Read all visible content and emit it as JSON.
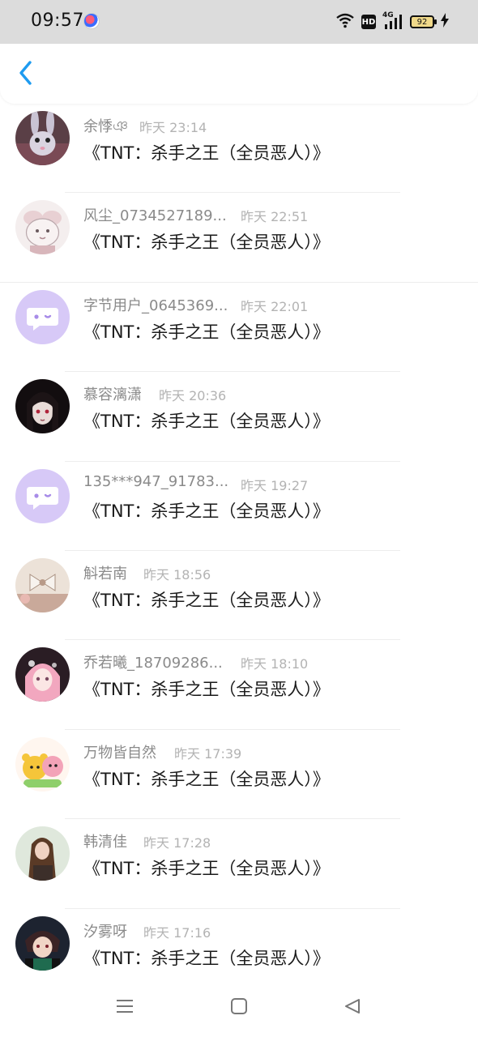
{
  "status_bar": {
    "time": "09:57",
    "hd_label": "HD",
    "network_label": "4G",
    "battery_level": "92"
  },
  "header": {
    "back_icon": "chevron-left-icon",
    "accent_color": "#1e9bf0"
  },
  "messages": [
    {
      "username": "余悸ঞ",
      "time": "昨天 23:14",
      "text": "《TNT：杀手之王（全员恶人）》",
      "avatar_icon": "bunny-avatar"
    },
    {
      "username": "风尘_0734527189...",
      "time": "昨天 22:51",
      "text": "《TNT：杀手之王（全员恶人）》",
      "avatar_icon": "sketch-avatar"
    },
    {
      "username": "字节用户_0645369...",
      "time": "昨天 22:01",
      "text": "《TNT：杀手之王（全员恶人）》",
      "avatar_icon": "default-chat-avatar"
    },
    {
      "username": "慕容漓潇",
      "time": "昨天 20:36",
      "text": "《TNT：杀手之王（全员恶人）》",
      "avatar_icon": "anime-girl-dark-avatar"
    },
    {
      "username": "135***947_91783...",
      "time": "昨天 19:27",
      "text": "《TNT：杀手之王（全员恶人）》",
      "avatar_icon": "default-chat-avatar"
    },
    {
      "username": "斛若南",
      "time": "昨天 18:56",
      "text": "《TNT：杀手之王（全员恶人）》",
      "avatar_icon": "bow-avatar"
    },
    {
      "username": "乔若曦_18709286...",
      "time": "昨天 18:10",
      "text": "《TNT：杀手之王（全员恶人）》",
      "avatar_icon": "anime-girl-pink-avatar"
    },
    {
      "username": "万物皆自然",
      "time": "昨天 17:39",
      "text": "《TNT：杀手之王（全员恶人）》",
      "avatar_icon": "cartoon-bear-avatar"
    },
    {
      "username": "韩清佳",
      "time": "昨天 17:28",
      "text": "《TNT：杀手之王（全员恶人）》",
      "avatar_icon": "photo-girl-avatar"
    },
    {
      "username": "汐雾呀",
      "time": "昨天 17:16",
      "text": "《TNT：杀手之王（全员恶人）》",
      "avatar_icon": "anime-character-avatar"
    }
  ],
  "nav": {
    "menu_icon": "menu-icon",
    "home_icon": "home-square-icon",
    "back_icon": "back-triangle-icon"
  }
}
